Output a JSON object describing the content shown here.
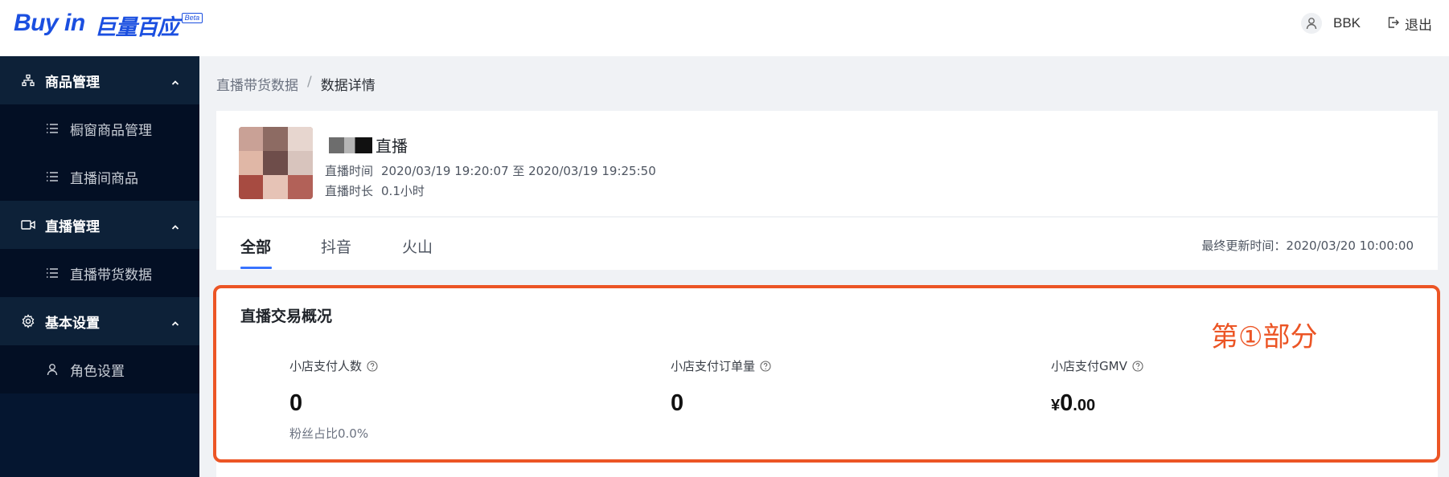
{
  "brand": {
    "name_en": "Buy in",
    "name_cn": "巨量百应",
    "badge": "Beta",
    "color": "#1b4fe0"
  },
  "header": {
    "username": "BBK",
    "logout_label": "退出"
  },
  "sidebar": {
    "groups": [
      {
        "label": "商品管理",
        "icon": "sitemap-icon",
        "items": [
          {
            "label": "橱窗商品管理",
            "icon": "list-icon"
          },
          {
            "label": "直播间商品",
            "icon": "list-icon"
          }
        ]
      },
      {
        "label": "直播管理",
        "icon": "video-icon",
        "items": [
          {
            "label": "直播带货数据",
            "icon": "list-icon"
          }
        ]
      },
      {
        "label": "基本设置",
        "icon": "gear-icon",
        "items": [
          {
            "label": "角色设置",
            "icon": "user-icon"
          }
        ]
      }
    ]
  },
  "breadcrumb": {
    "parent": "直播带货数据",
    "separator": "/",
    "current": "数据详情"
  },
  "live": {
    "title": "直播",
    "time_label": "直播时间",
    "time_value": "2020/03/19 19:20:07 至 2020/03/19 19:25:50",
    "duration_label": "直播时长",
    "duration_value": "0.1小时"
  },
  "tabs": {
    "items": [
      "全部",
      "抖音",
      "火山"
    ],
    "active": 0
  },
  "last_update": "最终更新时间：2020/03/20 10:00:00",
  "overview": {
    "title": "直播交易概况",
    "metrics": [
      {
        "label": "小店支付人数",
        "value": "0",
        "sub": "粉丝占比0.0%"
      },
      {
        "label": "小店支付订单量",
        "value": "0"
      },
      {
        "label": "小店支付GMV",
        "currency": "¥",
        "value": "0",
        "decimals": ".00"
      }
    ]
  },
  "annotation": {
    "text": "第①部分",
    "color": "#ec5525"
  }
}
